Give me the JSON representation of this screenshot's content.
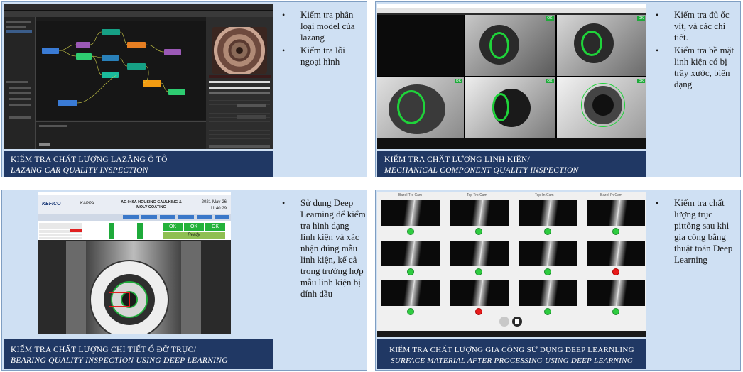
{
  "panels": [
    {
      "bullets": [
        "Kiểm tra phân loại model của lazang",
        "Kiểm tra lỗi ngoại hình"
      ],
      "caption_vn": "KIỂM TRA CHẤT LƯỢNG LAZĂNG Ô TÔ",
      "caption_en": "LAZANG CAR QUALITY INSPECTION"
    },
    {
      "bullets": [
        "Kiểm tra đủ ốc vít, và các chi tiết.",
        "Kiểm tra bề mặt linh kiện có bị trầy xước, biến dạng"
      ],
      "caption_vn": "KIỂM TRA CHẤT LƯỢNG LINH KIỆN/",
      "caption_en": "MECHANICAL COMPONENT QUALITY INSPECTION",
      "ok_label": "OK"
    },
    {
      "bullets": [
        "Sử dụng Deep Learning để kiểm tra hình dạng linh kiện và xác nhận đúng mẫu linh kiện, kể cả trong trường hợp mẫu linh kiện bị dính dầu"
      ],
      "caption_vn": "KIỂM TRA CHẤT LƯỢNG CHI TIẾT Ổ ĐỠ TRỤC/",
      "caption_en": "BEARING QUALITY INSPECTION USING DEEP LEARNING",
      "header_title": "AE-046A HOUSING CAULKING & MOLY COATING",
      "header_date": "2021-May-26",
      "header_time": "11:40:29",
      "brand": "KEFICO",
      "model": "KAPPA",
      "ready": "Ready",
      "ok_label": "OK"
    },
    {
      "bullets": [
        "Kiểm tra chất lượng trục pittông sau khi gia công bằng thuật toán Deep Learning"
      ],
      "caption_vn": "KIỂM TRA CHẤT LƯỢNG GIA CÔNG SỬ DỤNG DEEP LEARNLING",
      "caption_en": "SURFACE MATERIAL AFTER PROCESSING USING DEEP LEARNING",
      "columns": [
        "Bazel Tro Cam",
        "Top Tro Cam",
        "Top I'n Cam",
        "Bazel I'n Cam"
      ]
    }
  ],
  "colors": {
    "caption_bg": "#203864",
    "panel_bg": "#cfe0f3",
    "ok_green": "#2ecc40",
    "ng_red": "#e81b1b"
  }
}
